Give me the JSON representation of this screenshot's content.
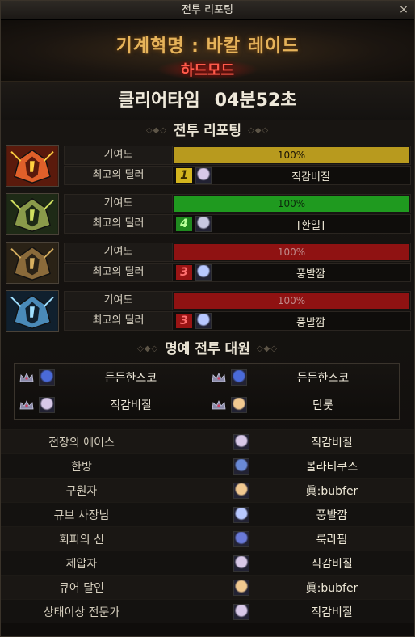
{
  "window": {
    "title": "전투 리포팅",
    "close_label": "×"
  },
  "hero": {
    "raid_name": "기계혁명 : 바칼 레이드",
    "mode": "하드모드"
  },
  "clear": {
    "label": "클리어타임",
    "time": "04분52초"
  },
  "sections": {
    "report": "전투 리포팅",
    "honor": "명예 전투 대원"
  },
  "labels": {
    "contribution": "기여도",
    "best_dealer": "최고의 딜러"
  },
  "bosses": [
    {
      "name": "fire-dragon",
      "contribution": "100%",
      "fill": 1.0,
      "bar_color": "#b89a1e",
      "bar_text_color": "#1a1406",
      "dealer_rank": "1",
      "rank_bg": "#d4b51e",
      "rank_fg": "#3a2a00",
      "dealer": "직감비질",
      "avatar_color": "#d8c8e8"
    },
    {
      "name": "wind-dragon",
      "contribution": "100%",
      "fill": 1.0,
      "bar_color": "#1f9a1f",
      "bar_text_color": "#0c2a0c",
      "dealer_rank": "4",
      "rank_bg": "#1f8a1f",
      "rank_fg": "#b8ff9a",
      "dealer": "[환일]",
      "avatar_color": "#c8c8e0"
    },
    {
      "name": "earth-dragon",
      "contribution": "100%",
      "fill": 1.0,
      "bar_color": "#8f1212",
      "bar_text_color": "#c08a8a",
      "dealer_rank": "3",
      "rank_bg": "#9a1414",
      "rank_fg": "#ff7070",
      "dealer": "풍발깜",
      "avatar_color": "#b8c8ff"
    },
    {
      "name": "ice-dragon",
      "contribution": "100%",
      "fill": 1.0,
      "bar_color": "#8f1212",
      "bar_text_color": "#c08a8a",
      "dealer_rank": "3",
      "rank_bg": "#9a1414",
      "rank_fg": "#ff7070",
      "dealer": "풍발깜",
      "avatar_color": "#b8c8ff"
    }
  ],
  "honor": [
    {
      "name": "든든한스코",
      "avatar_color": "#4a6ad8"
    },
    {
      "name": "든든한스코",
      "avatar_color": "#4a6ad8"
    },
    {
      "name": "직감비질",
      "avatar_color": "#d8c8e8"
    },
    {
      "name": "단룻",
      "avatar_color": "#f0c890"
    }
  ],
  "titles": [
    {
      "title": "전장의 에이스",
      "player": "직감비질",
      "avatar_color": "#d8c8e8"
    },
    {
      "title": "한방",
      "player": "볼라티쿠스",
      "avatar_color": "#6a8ad8"
    },
    {
      "title": "구원자",
      "player": "眞:bubfer",
      "avatar_color": "#f0c890"
    },
    {
      "title": "큐브 사장님",
      "player": "풍발깜",
      "avatar_color": "#b8c8ff"
    },
    {
      "title": "회피의 신",
      "player": "룩라핌",
      "avatar_color": "#6a7ad8"
    },
    {
      "title": "제압자",
      "player": "직감비질",
      "avatar_color": "#d8c8e8"
    },
    {
      "title": "큐어 달인",
      "player": "眞:bubfer",
      "avatar_color": "#f0c890"
    },
    {
      "title": "상태이상 전문가",
      "player": "직감비질",
      "avatar_color": "#d8c8e8"
    }
  ]
}
